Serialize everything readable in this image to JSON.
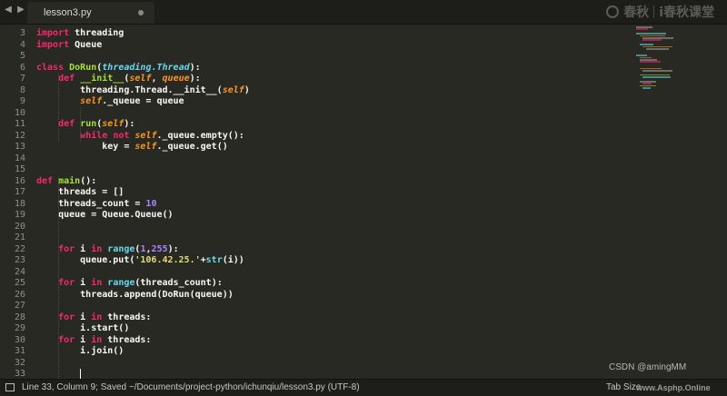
{
  "tab": {
    "title": "lesson3.py"
  },
  "nav": {
    "back": "◀",
    "forward": "▶"
  },
  "watermark": {
    "brand_cn": "春秋",
    "brand_cn2": "i春秋课堂",
    "csdn": "CSDN @amingMM",
    "site": "www.Asphp.Online"
  },
  "editor": {
    "line_numbers": [
      "3",
      "4",
      "5",
      "6",
      "7",
      "8",
      "9",
      "10",
      "11",
      "12",
      "13",
      "14",
      "15",
      "16",
      "17",
      "18",
      "19",
      "20",
      "21",
      "22",
      "23",
      "24",
      "25",
      "26",
      "27",
      "28",
      "29",
      "30",
      "31",
      "32",
      "33"
    ],
    "code_lines": [
      "import threading",
      "import Queue",
      "",
      "class DoRun(threading.Thread):",
      "    def __init__(self, queue):",
      "        threading.Thread.__init__(self)",
      "        self._queue = queue",
      "",
      "    def run(self):",
      "        while not self._queue.empty():",
      "            key = self._queue.get()",
      "",
      "",
      "def main():",
      "    threads = []",
      "    threads_count = 10",
      "    queue = Queue.Queue()",
      "",
      "",
      "    for i in range(1,255):",
      "        queue.put('106.42.25.'+str(i))",
      "",
      "    for i in range(threads_count):",
      "        threads.append(DoRun(queue))",
      "",
      "    for i in threads:",
      "        i.start()",
      "    for i in threads:",
      "        i.join()",
      "",
      "        "
    ]
  },
  "status": {
    "text": "Line 33, Column 9; Saved ~/Documents/project-python/ichunqiu/lesson3.py (UTF-8)",
    "tab_size": "Tab Size"
  },
  "colors": {
    "background": "#282923",
    "keyword": "#f92672",
    "function": "#a6e22e",
    "argument": "#fd971f",
    "number": "#ae81ff",
    "string": "#e6db74"
  }
}
